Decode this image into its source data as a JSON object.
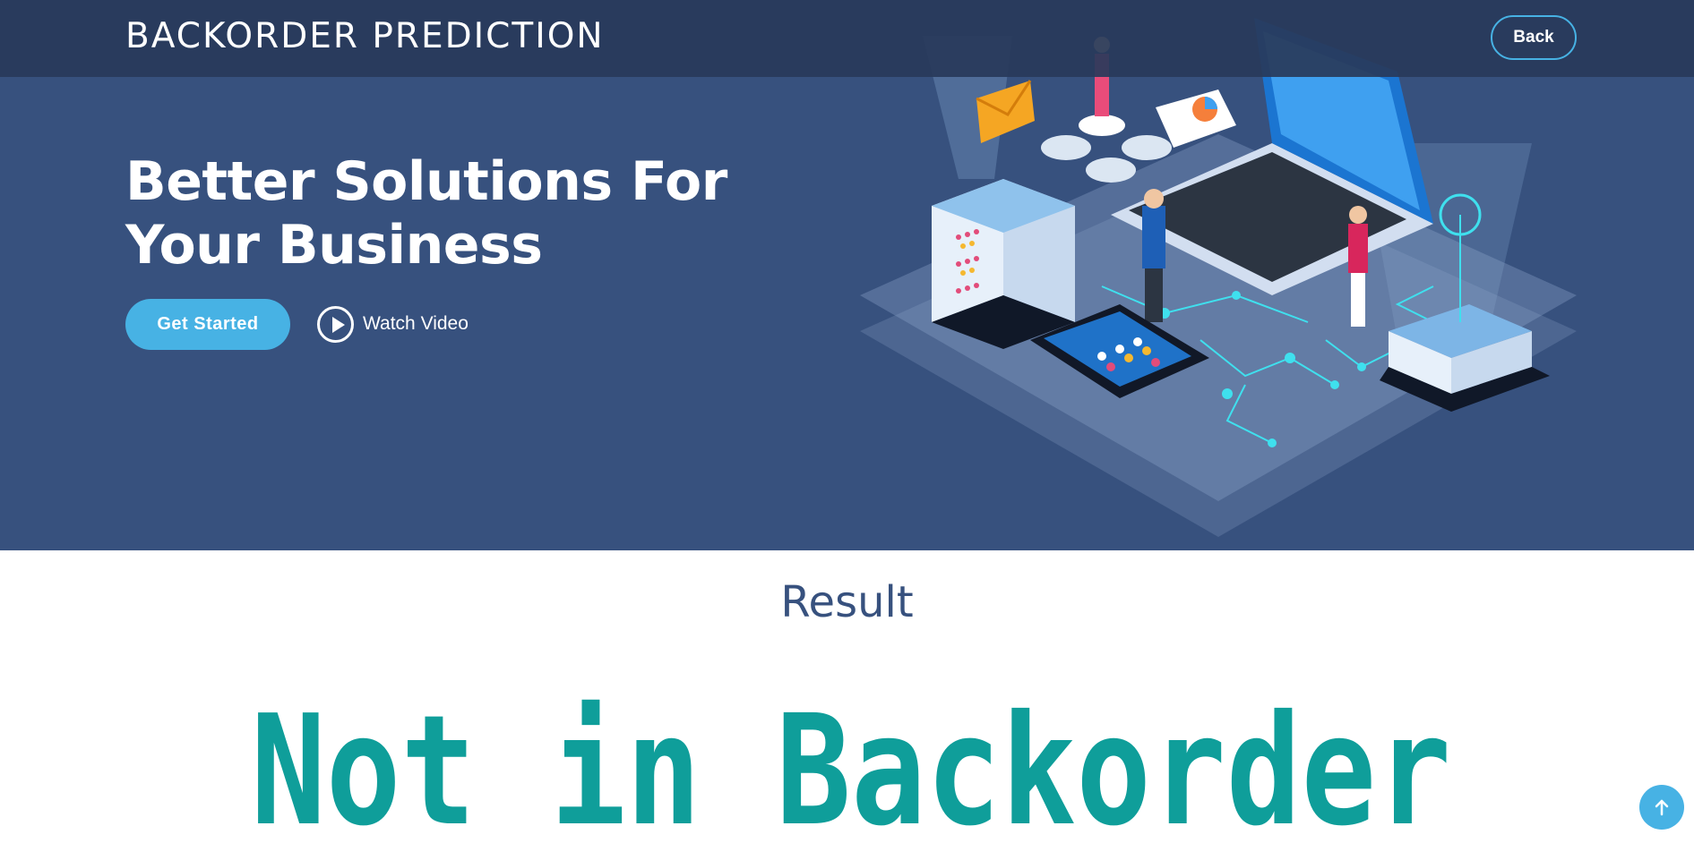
{
  "header": {
    "logo": "BACKORDER PREDICTION",
    "back_label": "Back"
  },
  "hero": {
    "title": "Better Solutions For Your Business",
    "get_started_label": "Get Started",
    "watch_video_label": "Watch Video",
    "icons": {
      "play": "play-circle-icon",
      "scroll": "arrow-up-icon"
    }
  },
  "result": {
    "heading": "Result",
    "value": "Not in Backorder"
  },
  "colors": {
    "hero_bg": "#37517e",
    "header_bg": "#2c3e5f",
    "accent": "#47b2e4",
    "result_text": "#0f9e9a"
  }
}
